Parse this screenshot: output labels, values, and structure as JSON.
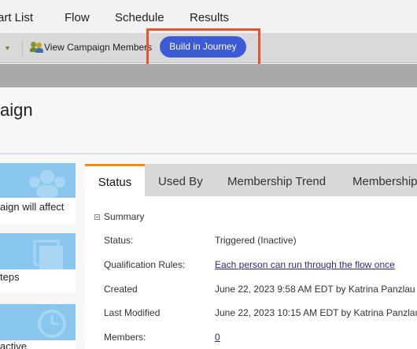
{
  "nav": {
    "tabs": [
      "art List",
      "Flow",
      "Schedule",
      "Results"
    ]
  },
  "toolbar": {
    "view_members": "View Campaign Members",
    "build_journey": "Build in Journey"
  },
  "page": {
    "title": "aign"
  },
  "cards": [
    {
      "label": "aign will affect",
      "icon": "people-icon"
    },
    {
      "label": "teps",
      "icon": "steps-icon"
    },
    {
      "label": "active",
      "icon": "clock-icon"
    }
  ],
  "panel": {
    "tabs": [
      "Status",
      "Used By",
      "Membership Trend",
      "Membership"
    ],
    "active_tab": "Status",
    "summary_label": "Summary",
    "rows": [
      {
        "label": "Status:",
        "value": "Triggered (Inactive)"
      },
      {
        "label": "Qualification Rules:",
        "value": "Each person can run through the flow once"
      },
      {
        "label": "Created",
        "value": "June 22, 2023 9:58 AM EDT by Katrina Panzlau"
      },
      {
        "label": "Last Modified",
        "value": "June 22, 2023 10:15 AM EDT by Katrina Panzlau"
      },
      {
        "label": "Members:",
        "value": "0"
      }
    ]
  },
  "colors": {
    "accent": "#3e5bd6",
    "highlight": "#e8532f",
    "tab_active": "#f08a1e",
    "card_band": "#88c6ee"
  }
}
